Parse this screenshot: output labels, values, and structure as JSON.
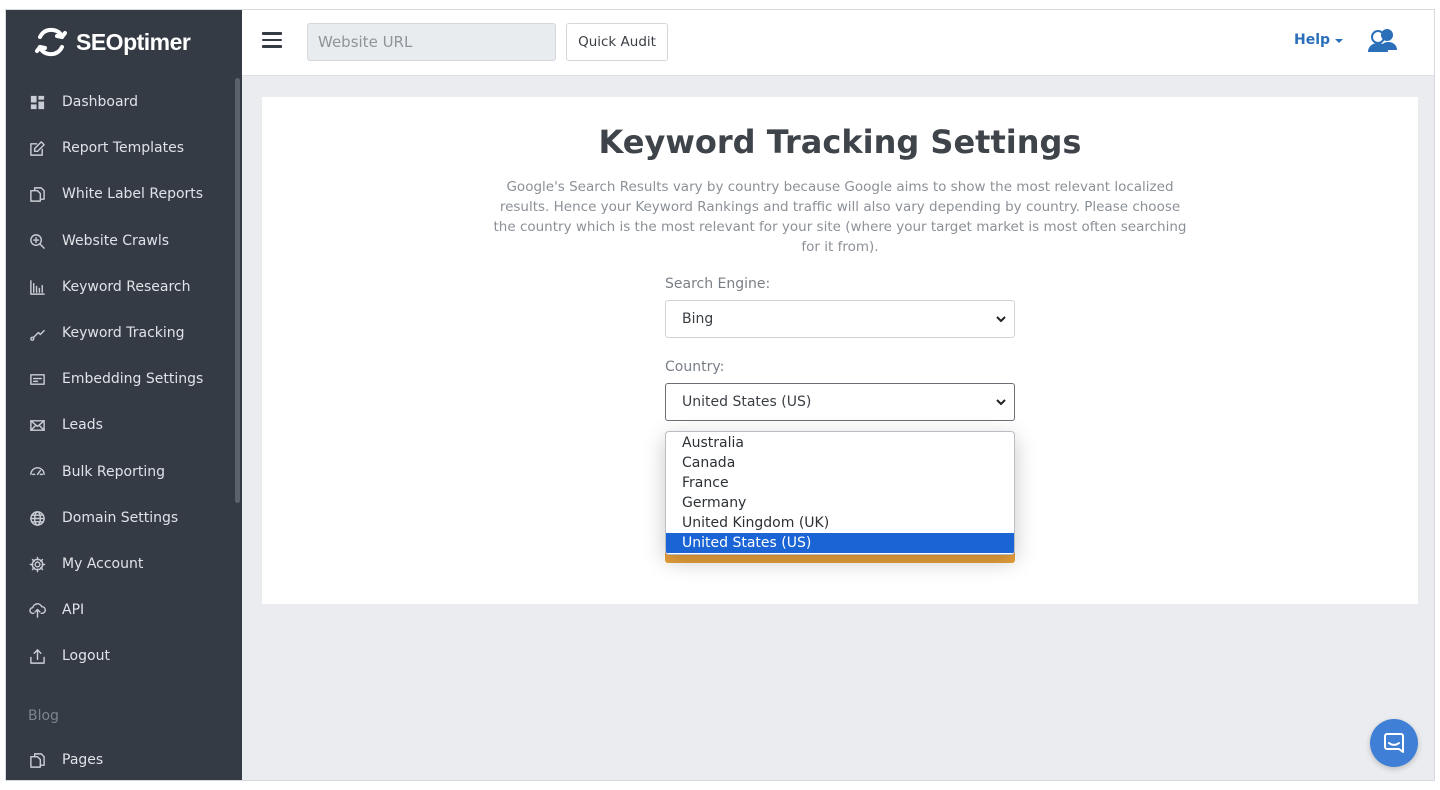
{
  "brand": {
    "name": "SEOptimer"
  },
  "sidebar": {
    "items": [
      {
        "label": "Dashboard",
        "icon": "dashboard-icon"
      },
      {
        "label": "Report Templates",
        "icon": "edit-icon"
      },
      {
        "label": "White Label Reports",
        "icon": "copy-icon"
      },
      {
        "label": "Website Crawls",
        "icon": "search-plus-icon"
      },
      {
        "label": "Keyword Research",
        "icon": "bar-chart-icon"
      },
      {
        "label": "Keyword Tracking",
        "icon": "trend-line-icon"
      },
      {
        "label": "Embedding Settings",
        "icon": "embed-icon"
      },
      {
        "label": "Leads",
        "icon": "envelope-icon"
      },
      {
        "label": "Bulk Reporting",
        "icon": "cloud-icon"
      },
      {
        "label": "Domain Settings",
        "icon": "globe-icon"
      },
      {
        "label": "My Account",
        "icon": "gear-icon"
      },
      {
        "label": "API",
        "icon": "cloud-upload-icon"
      },
      {
        "label": "Logout",
        "icon": "logout-icon"
      }
    ],
    "section_label": "Blog",
    "blog_items": [
      {
        "label": "Pages",
        "icon": "copy-icon"
      }
    ]
  },
  "header": {
    "url_placeholder": "Website URL",
    "quick_audit_label": "Quick Audit",
    "help_label": "Help"
  },
  "main": {
    "title": "Keyword Tracking Settings",
    "description": "Google's Search Results vary by country because Google aims to show the most relevant localized results. Hence your Keyword Rankings and traffic will also vary depending by country. Please choose the country which is the most relevant for your site (where your target market is most often searching for it from).",
    "search_engine_label": "Search Engine:",
    "search_engine_value": "Bing",
    "country_label": "Country:",
    "country_value": "United States (US)",
    "country_options": [
      "Australia",
      "Canada",
      "France",
      "Germany",
      "United Kingdom (UK)",
      "United States (US)"
    ],
    "country_selected": "United States (US)"
  },
  "colors": {
    "sidebar_bg": "#343b44",
    "accent_blue": "#2a6fb8",
    "selected_option": "#1a64d6",
    "save_button": "#e9a23b",
    "chat_bubble": "#3f7fd6"
  }
}
